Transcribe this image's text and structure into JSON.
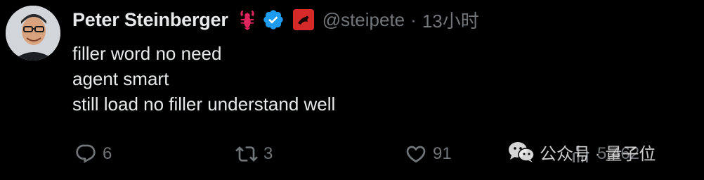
{
  "user": {
    "display_name": "Peter Steinberger",
    "emoji_icon": "lobster-emoji",
    "verified_icon": "verified-badge-icon",
    "affiliate_icon": "affiliate-badge-icon",
    "handle": "@steipete",
    "separator": "·",
    "timestamp": "13小时"
  },
  "tweet": {
    "lines": [
      "filler word no need",
      "agent smart",
      "still load no filler understand well"
    ]
  },
  "actions": {
    "reply_count": "6",
    "retweet_count": "3",
    "like_count": "91",
    "views_count": "5,462"
  },
  "watermark": {
    "text": "公众号 · 量子位"
  },
  "colors": {
    "background": "#000000",
    "text_primary": "#e7e9ea",
    "text_secondary": "#71767b",
    "verified_blue": "#1d9bf0",
    "lobster_red": "#e0245e"
  }
}
